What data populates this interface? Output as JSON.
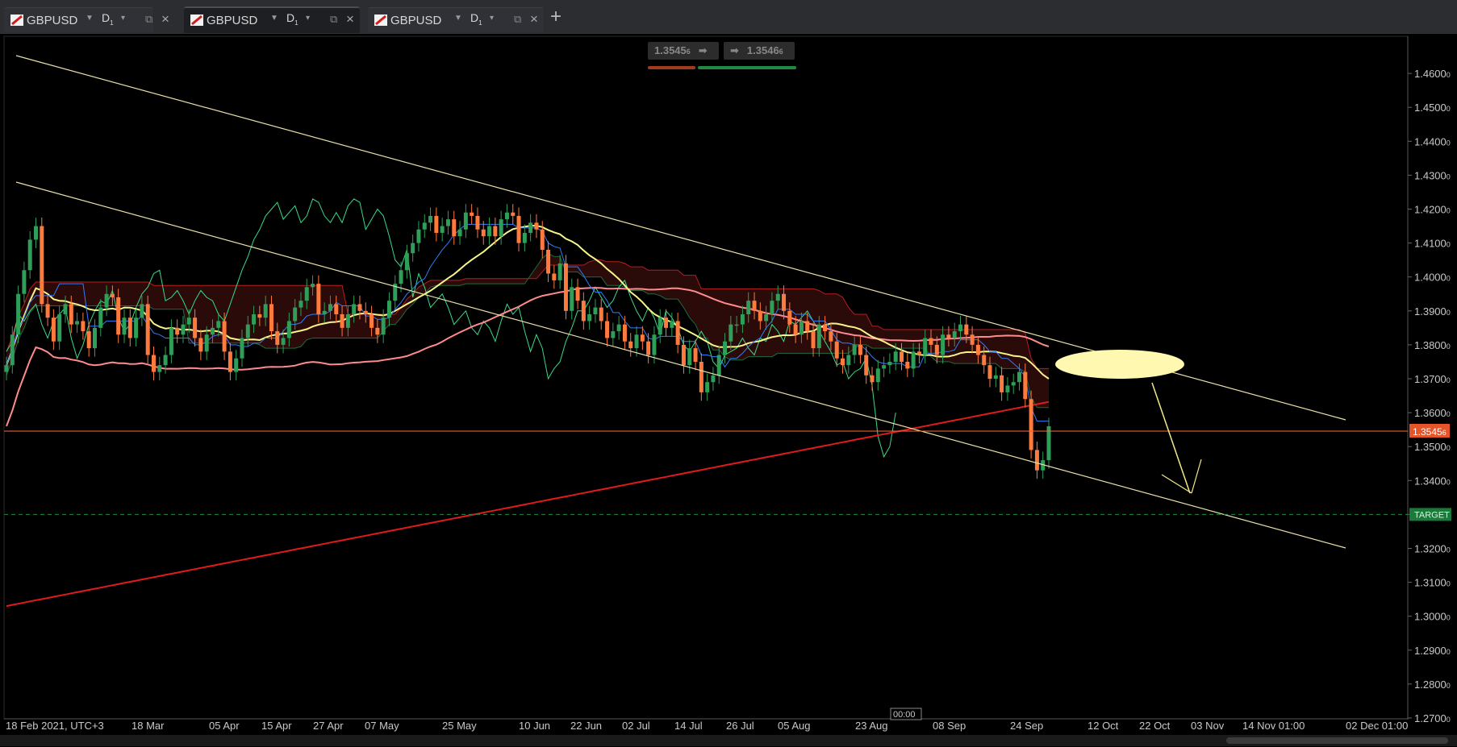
{
  "tabs": [
    {
      "symbol": "GBPUSD",
      "timeframe": "D",
      "timeframe_sub": "1",
      "active": false
    },
    {
      "symbol": "GBPUSD",
      "timeframe": "D",
      "timeframe_sub": "1",
      "active": true
    },
    {
      "symbol": "GBPUSD",
      "timeframe": "D",
      "timeframe_sub": "1",
      "active": false
    }
  ],
  "add_tab_label": "+",
  "quote": {
    "sell": "1.3545",
    "sell_small": "6",
    "buy": "1.3546",
    "buy_small": "6",
    "arrow": "➡"
  },
  "price_label": {
    "value": "1.3545",
    "small": "6"
  },
  "target_label": "TARGET",
  "crosshair_time": "00:00",
  "colors": {
    "bull": "#2e9e58",
    "bear": "#ff7a3d",
    "tenkan": "#2f7fff",
    "chikou": "#3bd98a",
    "ma_yellow": "#f5f58a",
    "ma_pink": "#ff8c8c",
    "ma_red": "#e01b1b",
    "price_line": "#ff6a3d",
    "target_line": "#1f8a44",
    "trendline": "#e8e0a8"
  },
  "chart_data": {
    "type": "candlestick",
    "symbol": "GBPUSD",
    "timeframe": "D1",
    "ylim": [
      1.265,
      1.47
    ],
    "y_ticks": [
      {
        "main": "1.4600",
        "small": "0"
      },
      {
        "main": "1.4500",
        "small": "0"
      },
      {
        "main": "1.4400",
        "small": "0"
      },
      {
        "main": "1.4300",
        "small": "0"
      },
      {
        "main": "1.4200",
        "small": "0"
      },
      {
        "main": "1.4100",
        "small": "0"
      },
      {
        "main": "1.4000",
        "small": "0"
      },
      {
        "main": "1.3900",
        "small": "0"
      },
      {
        "main": "1.3800",
        "small": "0"
      },
      {
        "main": "1.3700",
        "small": "0"
      },
      {
        "main": "1.3600",
        "small": "0"
      },
      {
        "main": "1.3500",
        "small": "0"
      },
      {
        "main": "1.3400",
        "small": "0"
      },
      {
        "main": "1.3300",
        "small": "0"
      },
      {
        "main": "1.3200",
        "small": "0"
      },
      {
        "main": "1.3100",
        "small": "0"
      },
      {
        "main": "1.3000",
        "small": "0"
      },
      {
        "main": "1.2900",
        "small": "0"
      },
      {
        "main": "1.2800",
        "small": "0"
      },
      {
        "main": "1.2700",
        "small": "0"
      }
    ],
    "x_ticks": [
      "18 Feb 2021, UTC+3",
      "18 Mar",
      "05 Apr",
      "15 Apr",
      "27 Apr",
      "07 May",
      "25 May",
      "10 Jun",
      "22 Jun",
      "02 Jul",
      "14 Jul",
      "26 Jul",
      "05 Aug",
      "23 Aug",
      "08 Sep",
      "24 Sep",
      "12 Oct",
      "22 Oct",
      "03 Nov",
      "14 Nov 01:00",
      "02 Dec 01:00"
    ],
    "current_price": 1.35456,
    "target_price": 1.33,
    "closes": [
      1.374,
      1.383,
      1.395,
      1.402,
      1.411,
      1.415,
      1.392,
      1.388,
      1.381,
      1.389,
      1.392,
      1.386,
      1.387,
      1.384,
      1.379,
      1.385,
      1.391,
      1.395,
      1.394,
      1.383,
      1.388,
      1.382,
      1.388,
      1.392,
      1.377,
      1.372,
      1.374,
      1.377,
      1.385,
      1.383,
      1.386,
      1.388,
      1.382,
      1.378,
      1.383,
      1.385,
      1.387,
      1.378,
      1.372,
      1.376,
      1.382,
      1.386,
      1.389,
      1.388,
      1.392,
      1.384,
      1.38,
      1.382,
      1.387,
      1.391,
      1.393,
      1.397,
      1.398,
      1.389,
      1.39,
      1.392,
      1.389,
      1.385,
      1.389,
      1.392,
      1.39,
      1.389,
      1.385,
      1.383,
      1.388,
      1.393,
      1.398,
      1.402,
      1.407,
      1.41,
      1.414,
      1.416,
      1.418,
      1.413,
      1.415,
      1.417,
      1.412,
      1.414,
      1.419,
      1.418,
      1.414,
      1.412,
      1.415,
      1.412,
      1.417,
      1.419,
      1.418,
      1.41,
      1.413,
      1.416,
      1.414,
      1.408,
      1.401,
      1.399,
      1.404,
      1.39,
      1.397,
      1.393,
      1.387,
      1.389,
      1.391,
      1.387,
      1.382,
      1.384,
      1.386,
      1.381,
      1.379,
      1.383,
      1.381,
      1.377,
      1.383,
      1.388,
      1.385,
      1.387,
      1.38,
      1.374,
      1.379,
      1.375,
      1.366,
      1.369,
      1.371,
      1.377,
      1.381,
      1.386,
      1.386,
      1.389,
      1.393,
      1.39,
      1.387,
      1.389,
      1.393,
      1.395,
      1.39,
      1.386,
      1.383,
      1.387,
      1.384,
      1.379,
      1.386,
      1.384,
      1.381,
      1.376,
      1.374,
      1.377,
      1.38,
      1.377,
      1.371,
      1.369,
      1.373,
      1.374,
      1.375,
      1.378,
      1.375,
      1.373,
      1.378,
      1.377,
      1.382,
      1.38,
      1.377,
      1.383,
      1.382,
      1.384,
      1.386,
      1.383,
      1.38,
      1.377,
      1.374,
      1.37,
      1.371,
      1.366,
      1.368,
      1.369,
      1.372,
      1.364,
      1.349,
      1.343,
      1.346,
      1.356
    ]
  }
}
